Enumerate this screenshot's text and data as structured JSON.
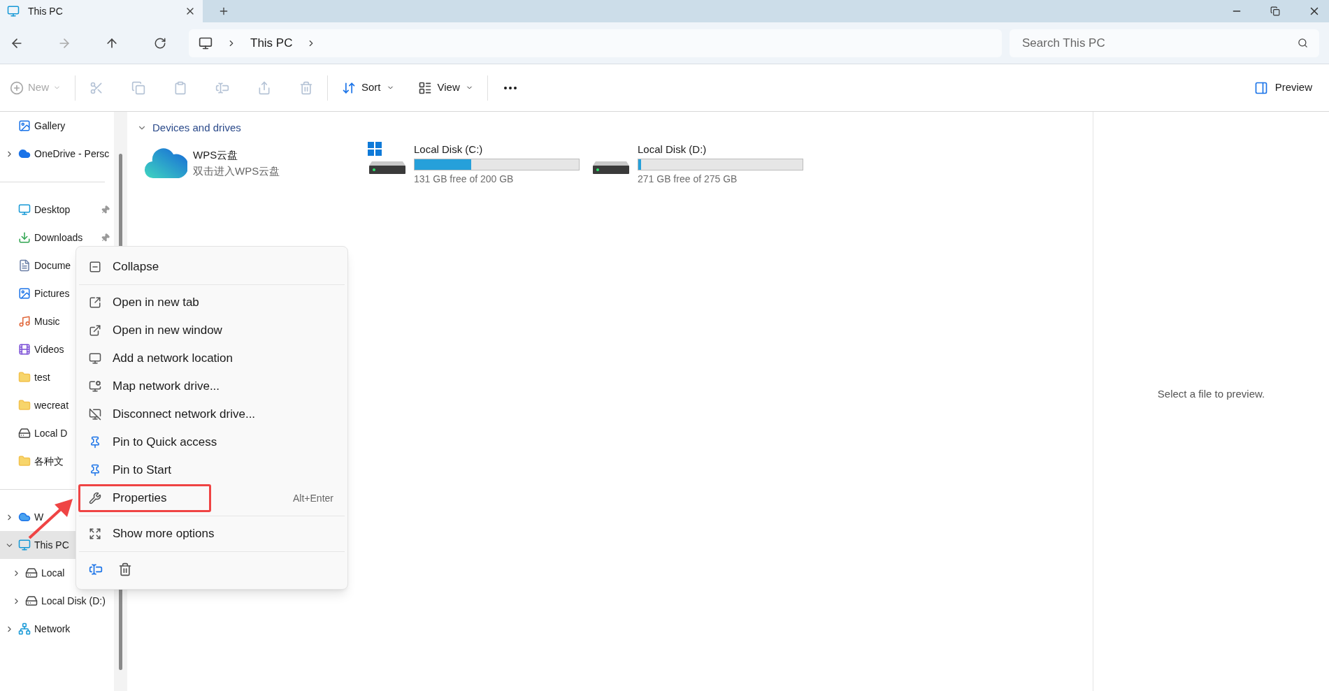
{
  "tab": {
    "title": "This PC"
  },
  "address": {
    "crumbs": [
      "This PC"
    ]
  },
  "search": {
    "placeholder": "Search This PC"
  },
  "toolbar": {
    "new": {
      "label": "New",
      "disabled": true
    },
    "sort": {
      "label": "Sort"
    },
    "view": {
      "label": "View"
    },
    "preview": {
      "label": "Preview"
    }
  },
  "sidebar": {
    "sections": [
      [
        {
          "label": "Gallery",
          "selected": false,
          "pinned": false
        },
        {
          "label": "OneDrive - Persc",
          "selected": false,
          "pinned": false,
          "expanded": false
        }
      ],
      [
        {
          "label": "Desktop",
          "selected": false,
          "pinned": true
        },
        {
          "label": "Downloads",
          "selected": false,
          "pinned": true
        },
        {
          "label": "Docume",
          "selected": false
        },
        {
          "label": "Pictures",
          "selected": false
        },
        {
          "label": "Music",
          "selected": false
        },
        {
          "label": "Videos",
          "selected": false
        },
        {
          "label": "test",
          "selected": false
        },
        {
          "label": "wecreat",
          "selected": false
        },
        {
          "label": "Local D",
          "selected": false
        },
        {
          "label": "各种文",
          "selected": false
        }
      ],
      [
        {
          "label": "W",
          "selected": false,
          "expanded": false
        },
        {
          "label": "This PC",
          "selected": true,
          "expanded": true,
          "children": [
            {
              "label": "Local",
              "selected": false,
              "expanded": false
            },
            {
              "label": "Local Disk (D:)",
              "selected": false,
              "pinned": false,
              "expanded": false
            }
          ]
        },
        {
          "label": "Network",
          "selected": false,
          "pinned": false,
          "expanded": false
        }
      ]
    ]
  },
  "section": {
    "title": "Devices and drives",
    "expanded": true
  },
  "drives": [
    {
      "kind": "cloud",
      "name": "WPS云盘",
      "subtitle": "双击进入WPS云盘"
    },
    {
      "kind": "disk",
      "system": true,
      "name": "Local Disk (C:)",
      "level": 0.345,
      "free": "131 GB free of 200 GB"
    },
    {
      "kind": "disk",
      "system": false,
      "name": "Local Disk (D:)",
      "level": 0.015,
      "free": "271 GB free of 275 GB"
    }
  ],
  "preview_pane": {
    "message": "Select a file to preview."
  },
  "context_menu": {
    "groups": [
      [
        {
          "label": "Collapse",
          "annotated": false
        }
      ],
      [
        {
          "label": "Open in new tab",
          "annotated": false
        },
        {
          "label": "Open in new window",
          "annotated": false
        },
        {
          "label": "Add a network location",
          "annotated": false
        },
        {
          "label": "Map network drive...",
          "annotated": false
        },
        {
          "label": "Disconnect network drive...",
          "annotated": false
        },
        {
          "label": "Pin to Quick access",
          "annotated": false
        },
        {
          "label": "Pin to Start",
          "annotated": false
        },
        {
          "label": "Properties",
          "shortcut": "Alt+Enter",
          "annotated": true
        }
      ],
      [
        {
          "label": "Show more options",
          "annotated": false
        }
      ]
    ]
  }
}
